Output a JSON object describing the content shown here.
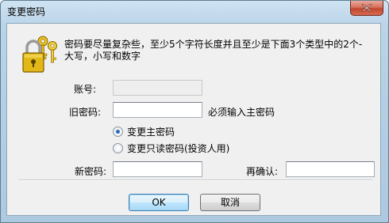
{
  "window": {
    "title": "变更密码"
  },
  "info": {
    "text": "密码要尽量复杂些，至少5个字符长度并且至少是下面3个类型中的2个-大写，小写和数字"
  },
  "form": {
    "account_label": "账号:",
    "account_value": "",
    "old_password_label": "旧密码:",
    "old_password_hint": "必须输入主密码",
    "radio_options": [
      {
        "label": "变更主密码",
        "checked": true
      },
      {
        "label": "变更只读密码(投资人用)",
        "checked": false
      }
    ],
    "new_password_label": "新密码:",
    "confirm_label": "再确认:"
  },
  "buttons": {
    "ok": "OK",
    "cancel": "取消"
  },
  "colors": {
    "title_bar": "#b9d3e8",
    "close_button": "#c2452d",
    "client_bg": "#f0f0f0",
    "default_button_border": "#3c7fb1"
  },
  "icons": {
    "dialog_icon": "lock-and-keys-icon",
    "close_icon": "close-icon"
  }
}
